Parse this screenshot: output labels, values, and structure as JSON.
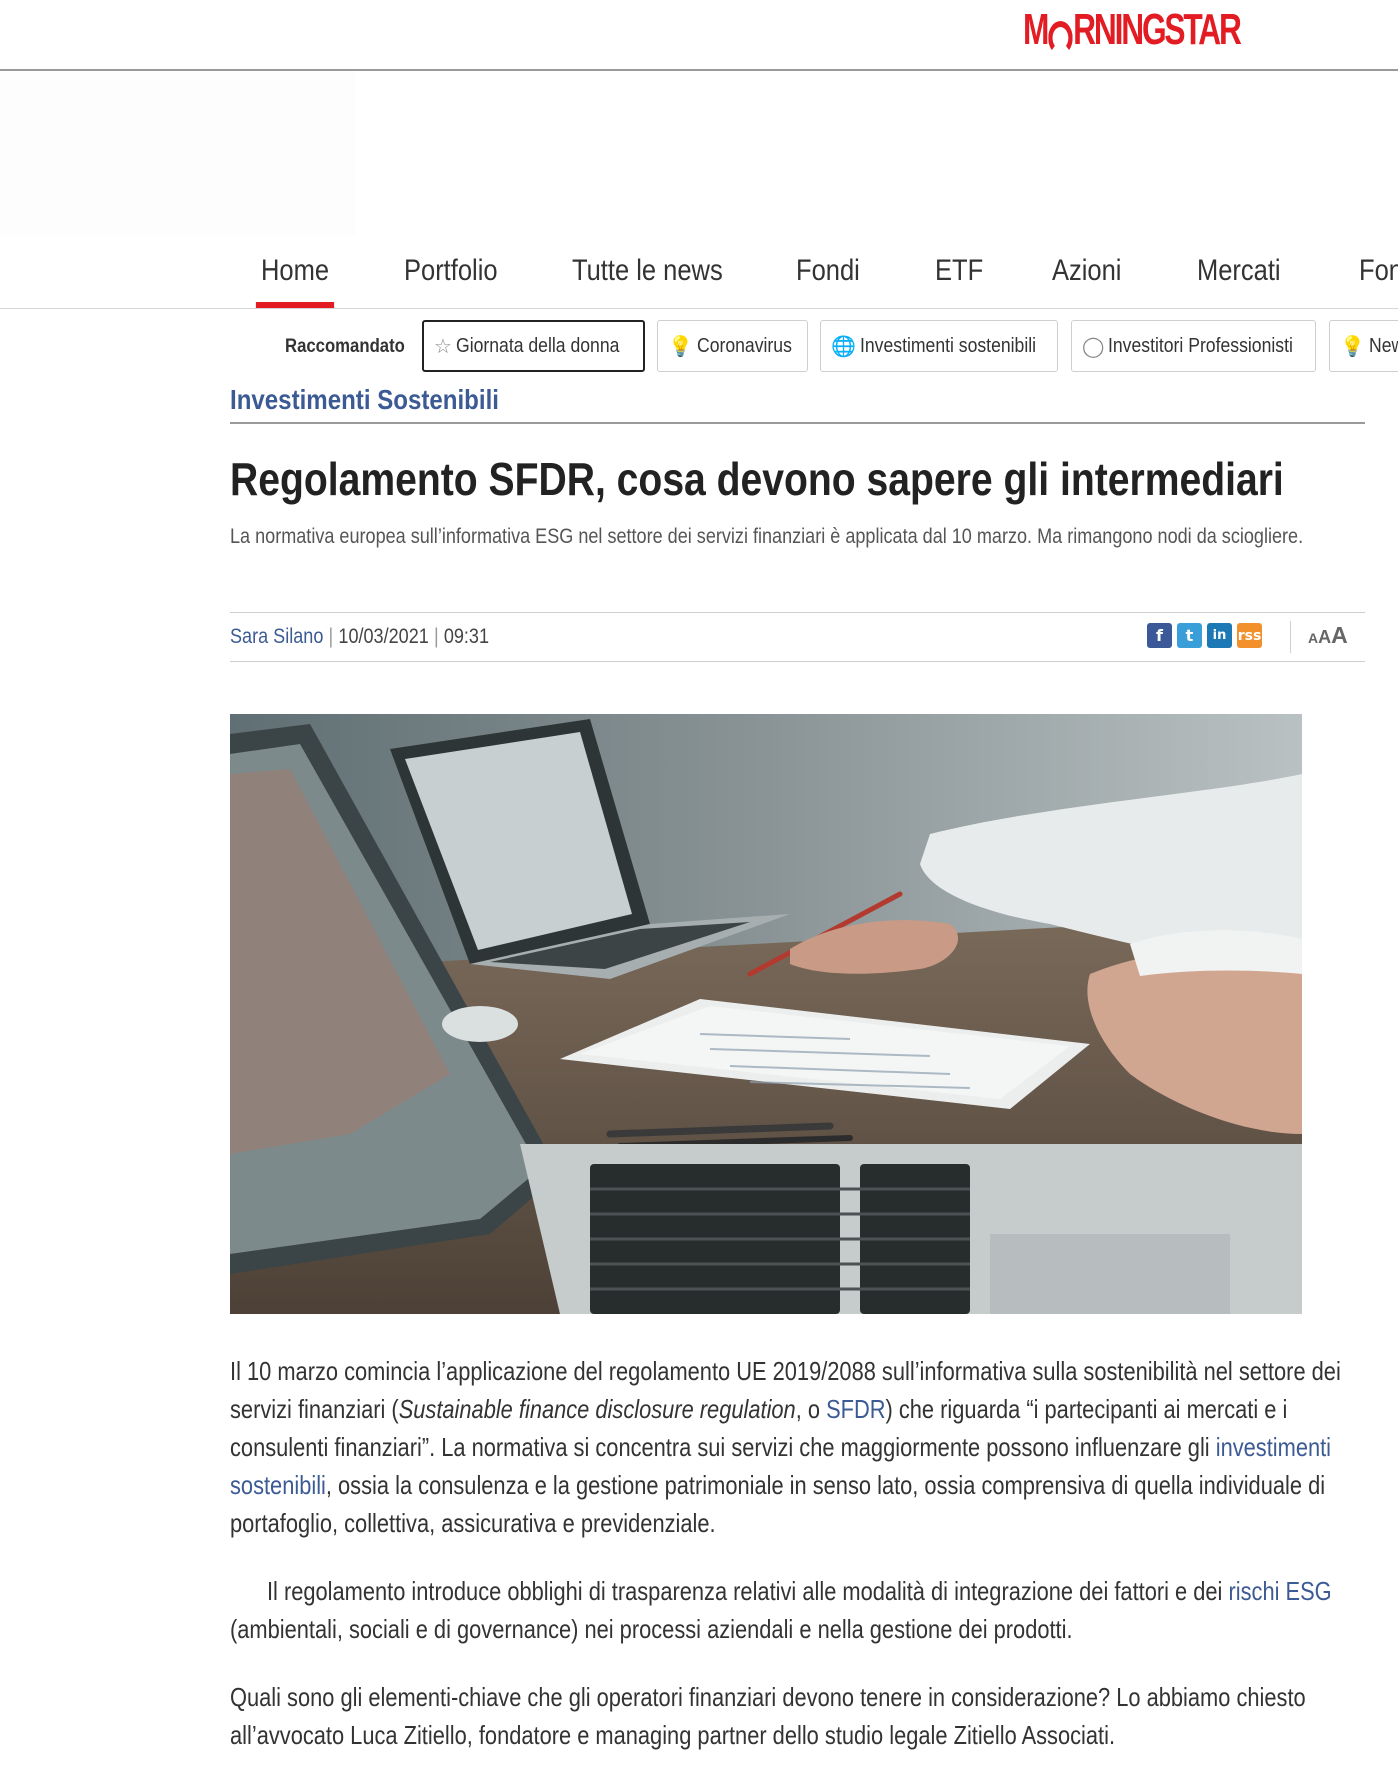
{
  "site": {
    "logo_left": "M",
    "logo_right": "RNINGSTAR"
  },
  "nav": {
    "items": [
      "Home",
      "Portfolio",
      "Tutte le news",
      "Fondi",
      "ETF",
      "Azioni",
      "Mercati",
      "Fon"
    ],
    "active": "Home"
  },
  "recommended": {
    "label": "Raccomandato",
    "chips": [
      {
        "label": "Giornata della donna",
        "icon": "star-icon",
        "selected": true
      },
      {
        "label": "Coronavirus",
        "icon": "lightbulb-icon",
        "selected": false
      },
      {
        "label": "Investimenti sostenibili",
        "icon": "globe-icon",
        "selected": false
      },
      {
        "label": "Investitori Professionisti",
        "icon": "circle-icon",
        "selected": false
      },
      {
        "label": "New",
        "icon": "lightbulb-icon",
        "selected": false
      }
    ]
  },
  "article": {
    "kicker": "Investimenti Sostenibili",
    "headline": "Regolamento SFDR, cosa devono sapere gli intermediari",
    "standfirst": "La normativa europea sull’informativa ESG nel settore dei servizi finanziari è applicata dal 10 marzo. Ma rimangono nodi da sciogliere.",
    "author": "Sara Silano",
    "date": "10/03/2021",
    "time": "09:31",
    "share": {
      "facebook": "f",
      "twitter": "t",
      "linkedin": "in",
      "rss": "rss"
    },
    "fontsize": {
      "small": "A",
      "medium": "A",
      "large": "A"
    },
    "p1": {
      "t1": "Il 10 marzo comincia l’applicazione del regolamento UE 2019/2088 sull’informativa sulla sostenibilità nel settore dei servizi finanziari (",
      "t2_italic": "Sustainable finance disclosure regulation",
      "t3": ", o ",
      "link1": "SFDR",
      "t4": ") che riguarda “i partecipanti ai mercati e i consulenti finanziari”. La normativa si concentra sui servizi che maggiormente possono influenzare gli ",
      "link2": "investimenti sostenibili",
      "t5": ", ossia la consulenza e la gestione patrimoniale in senso lato, ossia comprensiva di quella individuale di portafoglio, collettiva, assicurativa e previdenziale."
    },
    "p2": {
      "t1": "Il regolamento introduce obblighi di trasparenza relativi alle modalità di integrazione dei fattori e dei ",
      "link1": "rischi ESG",
      "t2": " (ambientali, sociali e di governance) nei processi aziendali e nella gestione dei prodotti."
    },
    "p3": "Quali sono gli elementi-chiave che gli operatori finanziari devono tenere in considerazione? Lo abbiamo chiesto all’avvocato Luca Zitiello, fondatore e managing partner dello studio legale Zitiello Associati."
  }
}
